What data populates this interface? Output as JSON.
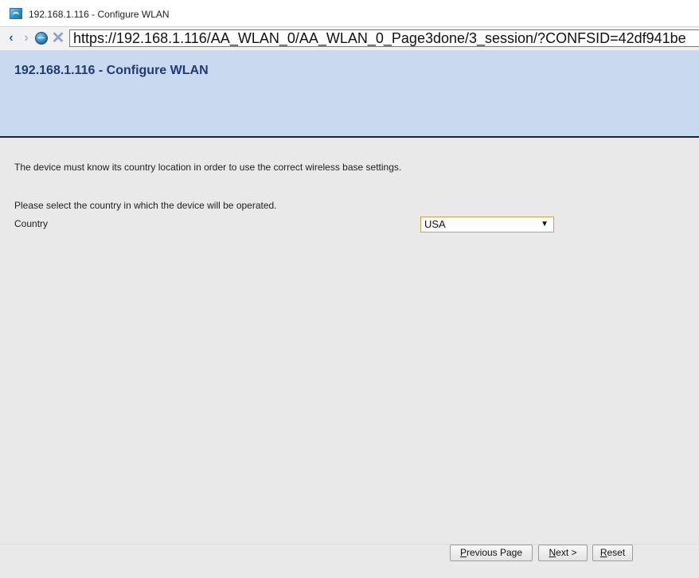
{
  "window": {
    "title": "192.168.1.116 - Configure WLAN"
  },
  "navigation": {
    "address": "https://192.168.1.116/AA_WLAN_0/AA_WLAN_0_Page3done/3_session/?CONFSID=42df941be"
  },
  "header": {
    "title": "192.168.1.116 - Configure WLAN"
  },
  "content": {
    "intro": "The device must know its country location in order to use the correct wireless base settings.",
    "prompt": "Please select the country in which the device will be operated.",
    "country_label": "Country",
    "country_value": "USA"
  },
  "buttons": {
    "previous": {
      "accesskey": "P",
      "rest": "revious Page"
    },
    "next": {
      "accesskey": "N",
      "rest": "ext >"
    },
    "reset": {
      "accesskey": "R",
      "rest": "eset"
    }
  },
  "icons": {
    "app": "browser-icon",
    "back": "back-icon",
    "forward": "forward-icon",
    "globe": "globe-icon",
    "stop": "stop-icon",
    "dropdown": "chevron-down-icon"
  }
}
